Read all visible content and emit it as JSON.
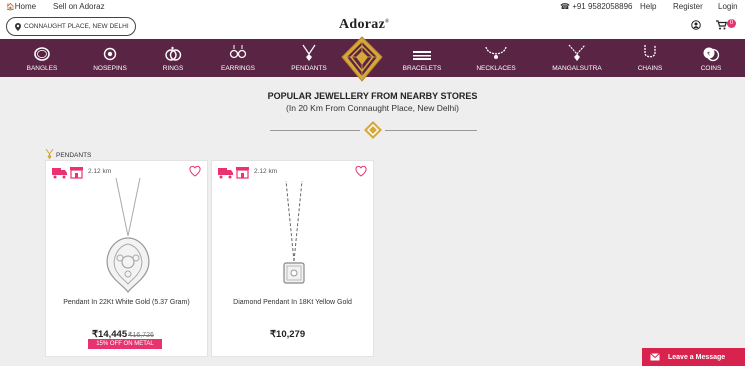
{
  "topbar": {
    "home": "Home",
    "sell": "Sell on Adoraz",
    "phone": "+91 9582058896",
    "help": "Help",
    "register": "Register",
    "login": "Login"
  },
  "header": {
    "location": "CONNAUGHT PLACE, NEW DELHI",
    "logo": "Adoraz",
    "logo_mark": "®",
    "cart_count": "0"
  },
  "nav": {
    "items": [
      {
        "label": "BANGLES",
        "icon": "bangle-icon"
      },
      {
        "label": "NOSEPINS",
        "icon": "nosepin-icon"
      },
      {
        "label": "RINGS",
        "icon": "rings-icon"
      },
      {
        "label": "EARRINGS",
        "icon": "earrings-icon"
      },
      {
        "label": "PENDANTS",
        "icon": "pendant-icon"
      },
      {
        "label": "BRACELETS",
        "icon": "bracelet-icon"
      },
      {
        "label": "NECKLACES",
        "icon": "necklace-icon"
      },
      {
        "label": "MANGALSUTRA",
        "icon": "mangalsutra-icon"
      },
      {
        "label": "CHAINS",
        "icon": "chain-icon"
      },
      {
        "label": "COINS",
        "icon": "coins-icon"
      }
    ]
  },
  "main": {
    "title": "POPULAR JEWELLERY FROM NEARBY STORES",
    "subtitle": "(In 20 Km From Connaught Place, New Delhi)",
    "section_label": "PENDANTS"
  },
  "products": [
    {
      "distance": "2.12 km",
      "name": "Pendant In 22Kt White Gold (5.37 Gram)",
      "price": "₹14,445",
      "old_price": "₹16,726",
      "offer": "15% OFF ON METAL"
    },
    {
      "distance": "2.12 km",
      "name": "Diamond Pendant In 18Kt Yellow Gold",
      "price": "₹10,279"
    }
  ],
  "leave_message": "Leave a Message",
  "colors": {
    "nav_bg": "#5a2545",
    "accent_pink": "#e8336f",
    "gold": "#d8a73a",
    "message_red": "#d9234f"
  }
}
